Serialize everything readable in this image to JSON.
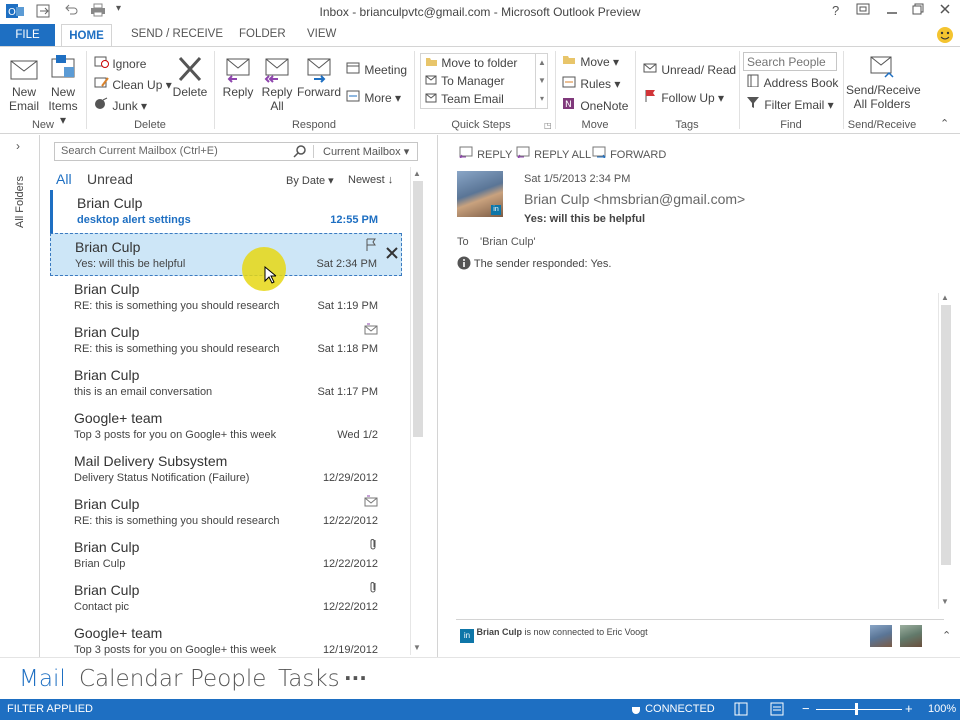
{
  "titlebar": {
    "title": "Inbox - brianculpvtc@gmail.com - Microsoft Outlook Preview",
    "help": "?"
  },
  "tabs": [
    "FILE",
    "HOME",
    "SEND / RECEIVE",
    "FOLDER",
    "VIEW"
  ],
  "ribbon": {
    "new_email": [
      "New",
      "Email"
    ],
    "new_items": [
      "New",
      "Items ▾"
    ],
    "ignore": "Ignore",
    "clean_up": "Clean Up ▾",
    "junk": "Junk ▾",
    "delete": "Delete",
    "reply": "Reply",
    "reply_all": [
      "Reply",
      "All"
    ],
    "forward": "Forward",
    "meeting": "Meeting",
    "more": "More ▾",
    "quick_steps": [
      "Move to folder",
      "To Manager",
      "Team Email"
    ],
    "move": "Move ▾",
    "rules": "Rules ▾",
    "onenote": "OneNote",
    "unread_read": "Unread/ Read",
    "follow_up": "Follow Up ▾",
    "search_people_placeholder": "Search People",
    "address_book": "Address Book",
    "filter_email": "Filter Email ▾",
    "send_receive_all": [
      "Send/Receive",
      "All Folders"
    ],
    "groups": [
      "New",
      "Delete",
      "Respond",
      "Quick Steps",
      "Move",
      "Tags",
      "Find",
      "Send/Receive"
    ]
  },
  "sidebar": {
    "all_folders": "All Folders"
  },
  "search": {
    "placeholder": "Search Current Mailbox (Ctrl+E)",
    "scope": "Current Mailbox"
  },
  "list": {
    "filter_all": "All",
    "filter_unread": "Unread",
    "sort": "By Date ▾",
    "order": "Newest ↓",
    "messages": [
      {
        "from": "Brian Culp",
        "subject": "desktop alert settings",
        "date": "12:55 PM",
        "unread": true
      },
      {
        "from": "Brian Culp",
        "subject": "Yes: will this be helpful",
        "date": "Sat 2:34 PM",
        "selected": true
      },
      {
        "from": "Brian Culp",
        "subject": "RE: this is something you should research",
        "date": "Sat 1:19 PM"
      },
      {
        "from": "Brian Culp",
        "subject": "RE: this is something you should research",
        "date": "Sat 1:18 PM"
      },
      {
        "from": "Brian Culp",
        "subject": "this is an email conversation",
        "date": "Sat 1:17 PM"
      },
      {
        "from": "Google+ team",
        "subject": "Top 3 posts for you on Google+ this week",
        "date": "Wed 1/2"
      },
      {
        "from": "Mail Delivery Subsystem",
        "subject": "Delivery Status Notification (Failure)",
        "date": "12/29/2012"
      },
      {
        "from": "Brian Culp",
        "subject": "RE: this is something you should research",
        "date": "12/22/2012"
      },
      {
        "from": "Brian Culp",
        "subject": "Brian Culp",
        "date": "12/22/2012"
      },
      {
        "from": "Brian Culp",
        "subject": "Contact pic",
        "date": "12/22/2012"
      },
      {
        "from": "Google+ team",
        "subject": "Top 3 posts for you on Google+ this week",
        "date": "12/19/2012"
      }
    ]
  },
  "reading": {
    "reply": "REPLY",
    "reply_all": "REPLY ALL",
    "forward": "FORWARD",
    "sent": "Sat 1/5/2013 2:34 PM",
    "from": "Brian Culp <hmsbrian@gmail.com>",
    "subject": "Yes: will this be helpful",
    "to_label": "To",
    "to": "'Brian Culp'",
    "info": "The sender responded: Yes.",
    "social_name": "Brian Culp",
    "social_text": "is now connected to Eric Voogt"
  },
  "nav": [
    "Mail",
    "Calendar",
    "People",
    "Tasks",
    "···"
  ],
  "status": {
    "left": "FILTER APPLIED",
    "connected": "CONNECTED",
    "zoom": "100%"
  },
  "colors": {
    "accent": "#1e6fc2",
    "selected_row": "#cde6f7",
    "unread": "#1e6fc2"
  }
}
